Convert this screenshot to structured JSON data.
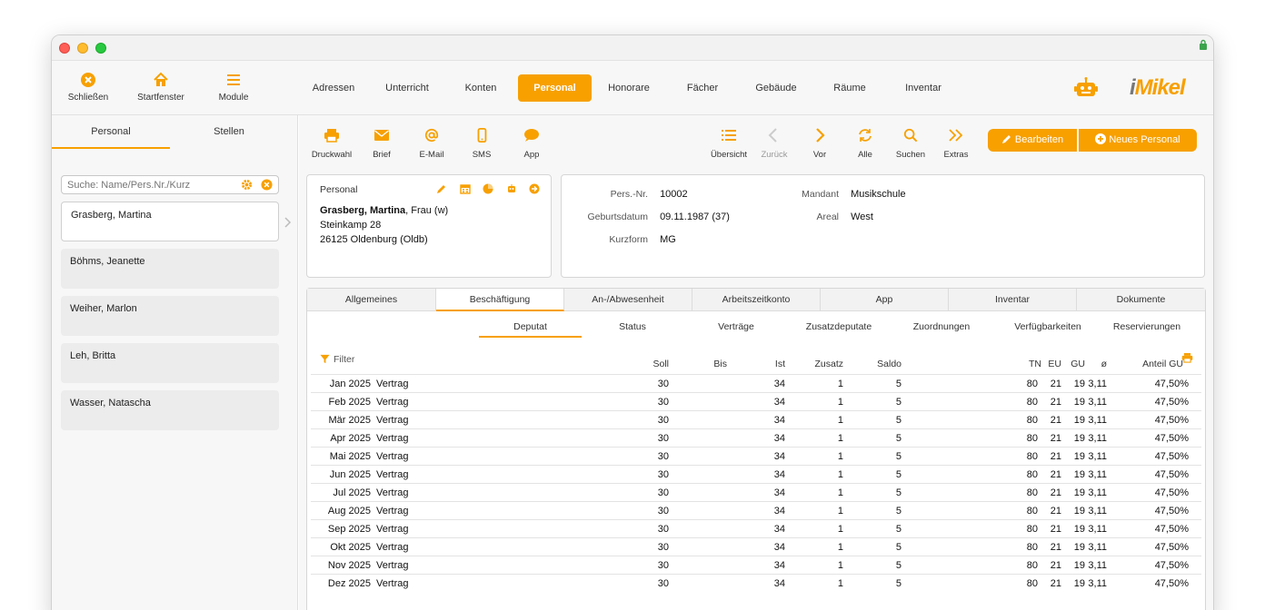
{
  "appbar": {
    "buttons": [
      {
        "label": "Schließen",
        "icon": "close-circle-icon"
      },
      {
        "label": "Startfenster",
        "icon": "home-icon"
      },
      {
        "label": "Module",
        "icon": "menu-icon"
      }
    ],
    "nav_tabs": [
      "Adressen",
      "Unterricht",
      "Konten",
      "Personal",
      "Honorare",
      "Fächer",
      "Gebäude",
      "Räume",
      "Inventar"
    ],
    "active_nav": "Personal",
    "logo": {
      "prefix": "i",
      "name": "Mikel"
    }
  },
  "sidebar": {
    "tabs": [
      "Personal",
      "Stellen"
    ],
    "search_placeholder": "Suche: Name/Pers.Nr./Kurz",
    "items": [
      "Grasberg, Martina",
      "Böhms, Jeanette",
      "Weiher, Marlon",
      "Leh, Britta",
      "Wasser, Natascha"
    ]
  },
  "toolbar": {
    "left": [
      "Druckwahl",
      "Brief",
      "E-Mail",
      "SMS",
      "App"
    ],
    "right": [
      "Übersicht",
      "Zurück",
      "Vor",
      "Alle",
      "Suchen",
      "Extras"
    ],
    "edit_label": "Bearbeiten",
    "new_label": "Neues Personal"
  },
  "person": {
    "header": "Personal",
    "name": "Grasberg, Martina",
    "salutation": ", Frau (w)",
    "street": "Steinkamp 28",
    "city": "26125 Oldenburg (Oldb)"
  },
  "details": {
    "pers_nr_label": "Pers.-Nr.",
    "pers_nr": "10002",
    "birth_label": "Geburtsdatum",
    "birth": "09.11.1987 (37)",
    "short_label": "Kurzform",
    "short": "MG",
    "mandant_label": "Mandant",
    "mandant": "Musikschule",
    "areal_label": "Areal",
    "areal": "West"
  },
  "tabs": [
    "Allgemeines",
    "Beschäftigung",
    "An-/Abwesenheit",
    "Arbeitszeitkonto",
    "App",
    "Inventar",
    "Dokumente"
  ],
  "active_tab": "Beschäftigung",
  "subtabs": [
    "Deputat",
    "Status",
    "Verträge",
    "Zusatzdeputate",
    "Zuordnungen",
    "Verfügbarkeiten",
    "Reservierungen"
  ],
  "active_subtab": "Deputat",
  "table": {
    "filter_label": "Filter",
    "columns": [
      "Soll",
      "Bis",
      "Ist",
      "Zusatz",
      "Saldo",
      "TN",
      "EU",
      "GU",
      "ø",
      "Anteil GU"
    ],
    "rows": [
      {
        "month": "Jan 2025",
        "type": "Vertrag",
        "soll": "30",
        "ist": "34",
        "zusatz": "1",
        "saldo": "5",
        "tn": "80",
        "eu": "21",
        "gu": "19",
        "avg": "3,11",
        "anteil": "47,50%"
      },
      {
        "month": "Feb 2025",
        "type": "Vertrag",
        "soll": "30",
        "ist": "34",
        "zusatz": "1",
        "saldo": "5",
        "tn": "80",
        "eu": "21",
        "gu": "19",
        "avg": "3,11",
        "anteil": "47,50%"
      },
      {
        "month": "Mär 2025",
        "type": "Vertrag",
        "soll": "30",
        "ist": "34",
        "zusatz": "1",
        "saldo": "5",
        "tn": "80",
        "eu": "21",
        "gu": "19",
        "avg": "3,11",
        "anteil": "47,50%"
      },
      {
        "month": "Apr 2025",
        "type": "Vertrag",
        "soll": "30",
        "ist": "34",
        "zusatz": "1",
        "saldo": "5",
        "tn": "80",
        "eu": "21",
        "gu": "19",
        "avg": "3,11",
        "anteil": "47,50%"
      },
      {
        "month": "Mai 2025",
        "type": "Vertrag",
        "soll": "30",
        "ist": "34",
        "zusatz": "1",
        "saldo": "5",
        "tn": "80",
        "eu": "21",
        "gu": "19",
        "avg": "3,11",
        "anteil": "47,50%"
      },
      {
        "month": "Jun 2025",
        "type": "Vertrag",
        "soll": "30",
        "ist": "34",
        "zusatz": "1",
        "saldo": "5",
        "tn": "80",
        "eu": "21",
        "gu": "19",
        "avg": "3,11",
        "anteil": "47,50%"
      },
      {
        "month": "Jul 2025",
        "type": "Vertrag",
        "soll": "30",
        "ist": "34",
        "zusatz": "1",
        "saldo": "5",
        "tn": "80",
        "eu": "21",
        "gu": "19",
        "avg": "3,11",
        "anteil": "47,50%"
      },
      {
        "month": "Aug 2025",
        "type": "Vertrag",
        "soll": "30",
        "ist": "34",
        "zusatz": "1",
        "saldo": "5",
        "tn": "80",
        "eu": "21",
        "gu": "19",
        "avg": "3,11",
        "anteil": "47,50%"
      },
      {
        "month": "Sep 2025",
        "type": "Vertrag",
        "soll": "30",
        "ist": "34",
        "zusatz": "1",
        "saldo": "5",
        "tn": "80",
        "eu": "21",
        "gu": "19",
        "avg": "3,11",
        "anteil": "47,50%"
      },
      {
        "month": "Okt 2025",
        "type": "Vertrag",
        "soll": "30",
        "ist": "34",
        "zusatz": "1",
        "saldo": "5",
        "tn": "80",
        "eu": "21",
        "gu": "19",
        "avg": "3,11",
        "anteil": "47,50%"
      },
      {
        "month": "Nov 2025",
        "type": "Vertrag",
        "soll": "30",
        "ist": "34",
        "zusatz": "1",
        "saldo": "5",
        "tn": "80",
        "eu": "21",
        "gu": "19",
        "avg": "3,11",
        "anteil": "47,50%"
      },
      {
        "month": "Dez 2025",
        "type": "Vertrag",
        "soll": "30",
        "ist": "34",
        "zusatz": "1",
        "saldo": "5",
        "tn": "80",
        "eu": "21",
        "gu": "19",
        "avg": "3,11",
        "anteil": "47,50%"
      }
    ]
  },
  "colors": {
    "accent": "#f7a000",
    "panel": "#f7f7f7",
    "border": "#d6d6d6"
  }
}
